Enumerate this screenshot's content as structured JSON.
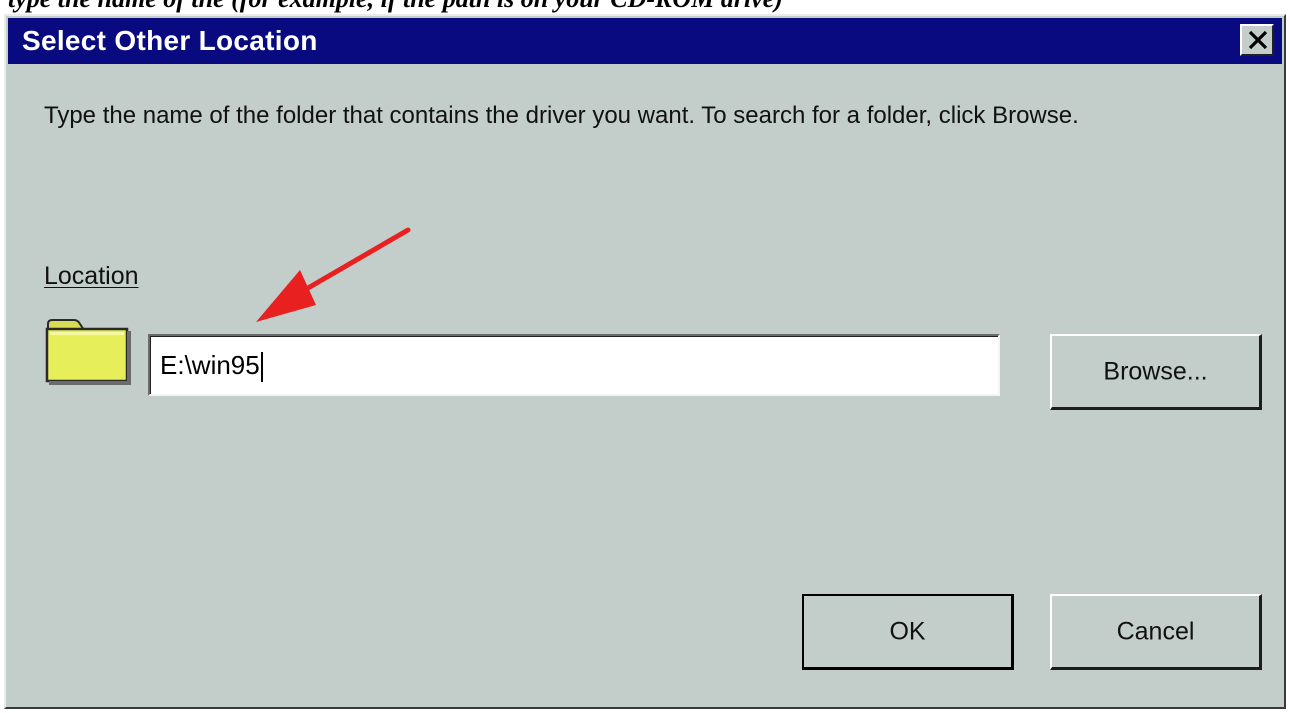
{
  "caption_fragment": "type the name of the (for example, if the path is on your CD-ROM drive)",
  "dialog": {
    "title": "Select Other Location",
    "close_glyph": "✕",
    "instructions": "Type the name of the folder that contains the driver you want. To search for a folder, click Browse.",
    "location_label": "Location",
    "location_value": "E:\\win95",
    "browse_label": "Browse...",
    "ok_label": "OK",
    "cancel_label": "Cancel"
  },
  "icons": {
    "folder": "folder-icon",
    "close": "close-icon",
    "annotation_arrow": "red-arrow"
  },
  "colors": {
    "titlebar": "#0a0a80",
    "dialog_bg": "#c3cdca",
    "folder": "#e6ee5a",
    "arrow": "#e82020"
  }
}
